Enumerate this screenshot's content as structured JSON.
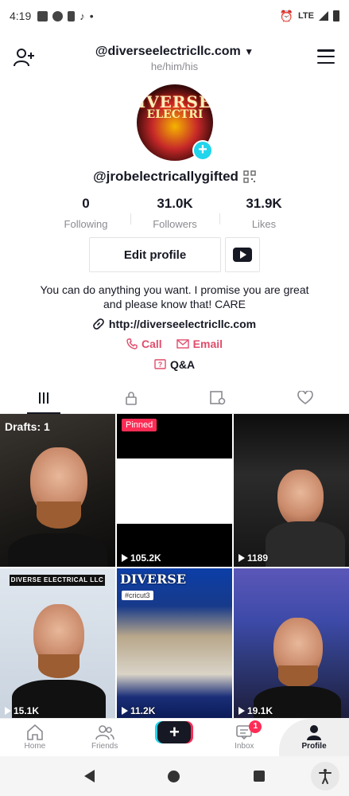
{
  "status_bar": {
    "time": "4:19",
    "dot": "•",
    "network": "LTE"
  },
  "header": {
    "account_name": "@diverseelectricllc.com",
    "pronouns": "he/him/his"
  },
  "avatar": {
    "line1": "IVERSE",
    "line2": "ELECTRI"
  },
  "profile": {
    "username": "@jrobelectricallygifted",
    "stats": [
      {
        "value": "0",
        "label": "Following"
      },
      {
        "value": "31.0K",
        "label": "Followers"
      },
      {
        "value": "31.9K",
        "label": "Likes"
      }
    ],
    "edit_label": "Edit profile",
    "bio_line1": "You can do anything you want. I promise you are great",
    "bio_line2": "and please know that! CARE",
    "link": "http://diverseelectricllc.com",
    "call_label": "Call",
    "email_label": "Email",
    "qa_label": "Q&A"
  },
  "tabs": [
    "videos-icon",
    "lock-icon",
    "tagged-icon",
    "heart-icon"
  ],
  "videos": [
    {
      "overlay": "Drafts: 1",
      "views": ""
    },
    {
      "overlay": "Pinned",
      "views": "105.2K"
    },
    {
      "overlay": "",
      "views": "1189"
    },
    {
      "overlay": "DIVERSE ELECTRICAL LLC",
      "views": "15.1K"
    },
    {
      "overlay": "DIVERSE",
      "tag": "#cricut3",
      "views": "11.2K"
    },
    {
      "overlay": "",
      "views": "19.1K"
    }
  ],
  "bottom_nav": [
    {
      "label": "Home"
    },
    {
      "label": "Friends"
    },
    {
      "label": "+"
    },
    {
      "label": "Inbox",
      "badge": "1"
    },
    {
      "label": "Profile"
    }
  ],
  "colors": {
    "accent": "#fe2c55",
    "cyan": "#20d5ec",
    "contact": "#e04d6c"
  }
}
